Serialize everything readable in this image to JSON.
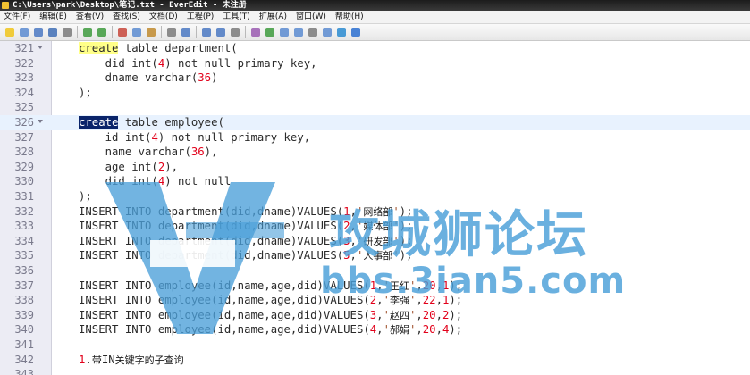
{
  "window": {
    "title": "C:\\Users\\park\\Desktop\\笔记.txt - EverEdit - 未注册"
  },
  "menu": [
    "文件(F)",
    "编辑(E)",
    "查看(V)",
    "查找(S)",
    "文档(D)",
    "工程(P)",
    "工具(T)",
    "扩展(A)",
    "窗口(W)",
    "帮助(H)"
  ],
  "toolbar": {
    "icons": [
      "new-file-icon",
      "open-icon",
      "save-icon",
      "save-all-icon",
      "print-icon",
      "undo-icon",
      "redo-icon",
      "cut-icon",
      "copy-icon",
      "paste-icon",
      "format-icon",
      "find-icon",
      "replace-icon",
      "find-in-files-icon",
      "settings-icon",
      "macro-icon",
      "run-icon",
      "column-mode-icon",
      "word-wrap-icon",
      "split-icon",
      "fullscreen-icon",
      "browser-icon",
      "help-icon"
    ]
  },
  "editor": {
    "lines": [
      {
        "n": "321",
        "fold": true,
        "code": "create table department("
      },
      {
        "n": "322",
        "fold": false,
        "code": "    did int(4) not null primary key,"
      },
      {
        "n": "323",
        "fold": false,
        "code": "    dname varchar(36)"
      },
      {
        "n": "324",
        "fold": false,
        "code": ");"
      },
      {
        "n": "325",
        "fold": false,
        "code": ""
      },
      {
        "n": "326",
        "fold": true,
        "code": "create table employee("
      },
      {
        "n": "327",
        "fold": false,
        "code": "    id int(4) not null primary key,"
      },
      {
        "n": "328",
        "fold": false,
        "code": "    name varchar(36),"
      },
      {
        "n": "329",
        "fold": false,
        "code": "    age int(2),"
      },
      {
        "n": "330",
        "fold": false,
        "code": "    did int(4) not null"
      },
      {
        "n": "331",
        "fold": false,
        "code": ");"
      },
      {
        "n": "332",
        "fold": false,
        "code": "INSERT INTO department(did,dname)VALUES(1,'网络部');"
      },
      {
        "n": "333",
        "fold": false,
        "code": "INSERT INTO department(did,dname)VALUES(2,'媒体部');"
      },
      {
        "n": "334",
        "fold": false,
        "code": "INSERT INTO department(did,dname)VALUES(3,'研发部');"
      },
      {
        "n": "335",
        "fold": false,
        "code": "INSERT INTO department(did,dname)VALUES(5,'人事部');"
      },
      {
        "n": "336",
        "fold": false,
        "code": ""
      },
      {
        "n": "337",
        "fold": false,
        "code": "INSERT INTO employee(id,name,age,did)VALUES(1,'王红',20,1);"
      },
      {
        "n": "338",
        "fold": false,
        "code": "INSERT INTO employee(id,name,age,did)VALUES(2,'李强',22,1);"
      },
      {
        "n": "339",
        "fold": false,
        "code": "INSERT INTO employee(id,name,age,did)VALUES(3,'赵四',20,2);"
      },
      {
        "n": "340",
        "fold": false,
        "code": "INSERT INTO employee(id,name,age,did)VALUES(4,'郝娟',20,4);"
      },
      {
        "n": "341",
        "fold": false,
        "code": ""
      },
      {
        "n": "342",
        "fold": false,
        "code": "1.带IN关键字的子查询"
      },
      {
        "n": "343",
        "fold": false,
        "code": ""
      }
    ],
    "current_line": "326",
    "highlights": {
      "321": "yellow",
      "326": "selection"
    }
  },
  "watermark": {
    "text_cn": "攻城狮论坛",
    "text_url": "bbs.3ian5.com",
    "color": "#4a9fd8"
  }
}
